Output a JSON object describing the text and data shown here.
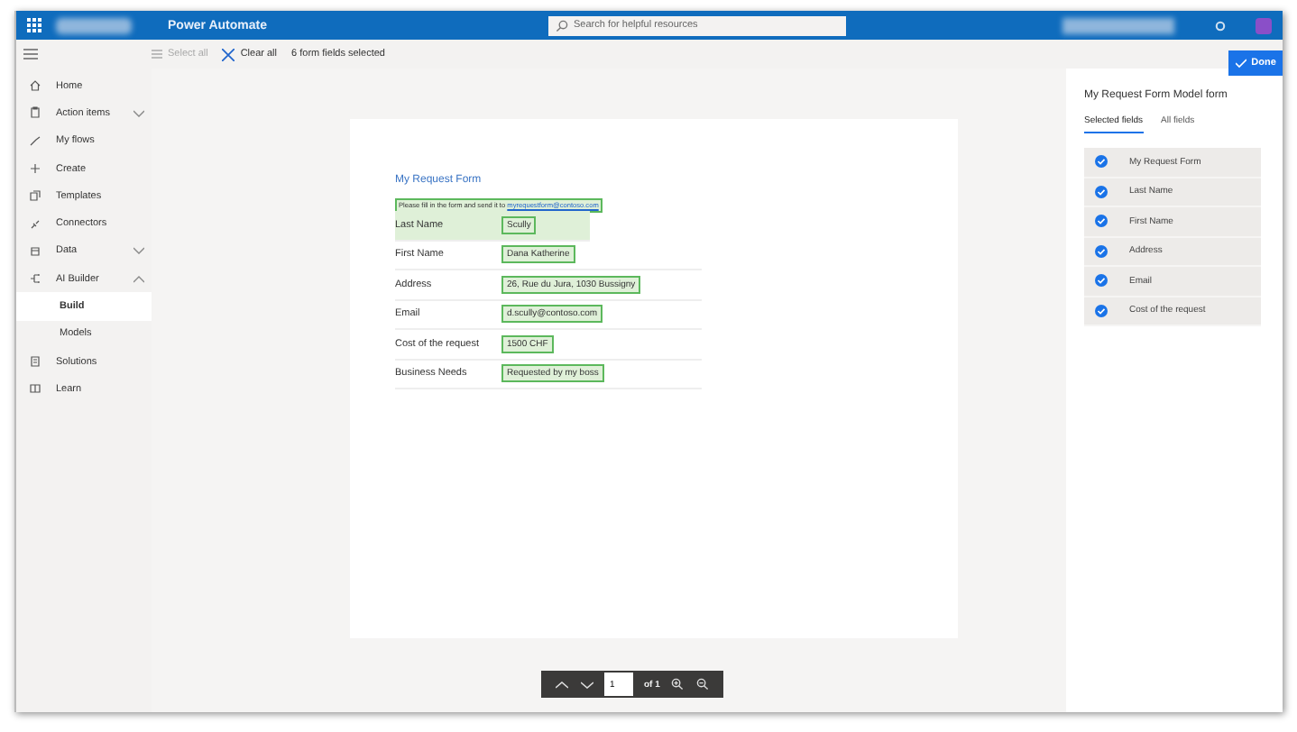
{
  "header": {
    "app_name": "Power Automate",
    "search": {
      "placeholder": "Search for helpful resources"
    }
  },
  "toolbar": {
    "select_all": {
      "label": "Select all",
      "disabled": true
    },
    "clear_all": {
      "label": "Clear all",
      "disabled": false
    },
    "status": "6 form fields selected",
    "done": "Done"
  },
  "sidebar": {
    "items": [
      {
        "label": "Home"
      },
      {
        "label": "Action items",
        "expanded": false
      },
      {
        "label": "My flows"
      },
      {
        "label": "Create"
      },
      {
        "label": "Templates"
      },
      {
        "label": "Connectors"
      },
      {
        "label": "Data",
        "expanded": false
      },
      {
        "label": "AI Builder",
        "expanded": true,
        "children": [
          {
            "label": "Build",
            "selected": true
          },
          {
            "label": "Models",
            "selected": false
          }
        ]
      },
      {
        "label": "Solutions"
      },
      {
        "label": "Learn"
      }
    ]
  },
  "document": {
    "title": "My Request Form",
    "intro": "Please fill in the form and send it to ",
    "intro_link": "myrequestform@contoso.com",
    "rows": [
      {
        "label": "Last Name",
        "value": "Scully",
        "highlighted": true
      },
      {
        "label": "First Name",
        "value": "Dana Katherine",
        "highlighted": true
      },
      {
        "label": "Address",
        "value": "26, Rue du Jura, 1030 Bussigny",
        "highlighted": true
      },
      {
        "label": "Email",
        "value": "d.scully@contoso.com",
        "highlighted": true
      },
      {
        "label": "Cost of the request",
        "value": "1500 CHF",
        "highlighted": true
      },
      {
        "label": "Business Needs",
        "value": "Requested by my boss",
        "highlighted": true
      }
    ]
  },
  "pager": {
    "page": "1",
    "of": "of 1"
  },
  "panel": {
    "title": "My Request Form Model form",
    "tabs": [
      {
        "label": "Selected fields",
        "selected": true
      },
      {
        "label": "All fields",
        "selected": false
      }
    ],
    "fields": [
      {
        "label": "My Request Form",
        "checked": true
      },
      {
        "label": "Last Name",
        "checked": true
      },
      {
        "label": "First Name",
        "checked": true
      },
      {
        "label": "Address",
        "checked": true
      },
      {
        "label": "Email",
        "checked": true
      },
      {
        "label": "Cost of the request",
        "checked": true
      }
    ]
  }
}
